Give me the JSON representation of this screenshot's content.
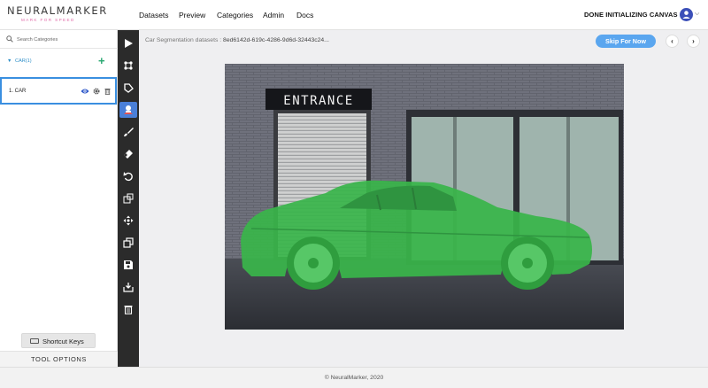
{
  "brand": {
    "name": "NEURALMARKER",
    "tagline": "MARK FOR SPEED"
  },
  "nav": {
    "links": [
      "Datasets",
      "Preview",
      "Categories",
      "Admin",
      "Docs"
    ],
    "status": "DONE INITIALIZING CANVAS"
  },
  "sidebar": {
    "search_placeholder": "Search Categories",
    "category": {
      "name": "CAR(1)"
    },
    "item": {
      "label": "1. CAR"
    },
    "shortcut_label": "Shortcut Keys",
    "tool_options_label": "TOOL OPTIONS"
  },
  "toolbar": {
    "tools": [
      "pointer-icon",
      "polygon-points-icon",
      "polygon-icon",
      "smart-select-icon",
      "brush-icon",
      "eraser-icon",
      "undo-icon",
      "box-select-icon",
      "move-icon",
      "copy-icon",
      "save-icon",
      "download-icon",
      "trash-icon"
    ],
    "active_tool": "smart-select-icon"
  },
  "main": {
    "breadcrumb_prefix": "Car Segmentation datasets :",
    "breadcrumb_id": "8ed6142d-619c-4286-9d6d-32443c24...",
    "skip_label": "Skip For Now",
    "prev_label": "‹",
    "next_label": "›",
    "sign_text": "ENTRANCE"
  },
  "footer": {
    "text": "© NeuralMarker, 2020"
  },
  "colors": {
    "accent": "#3a8fe0",
    "mask": "#39b54a",
    "toolbar": "#2b2b2b",
    "skip": "#5aa6ef"
  }
}
